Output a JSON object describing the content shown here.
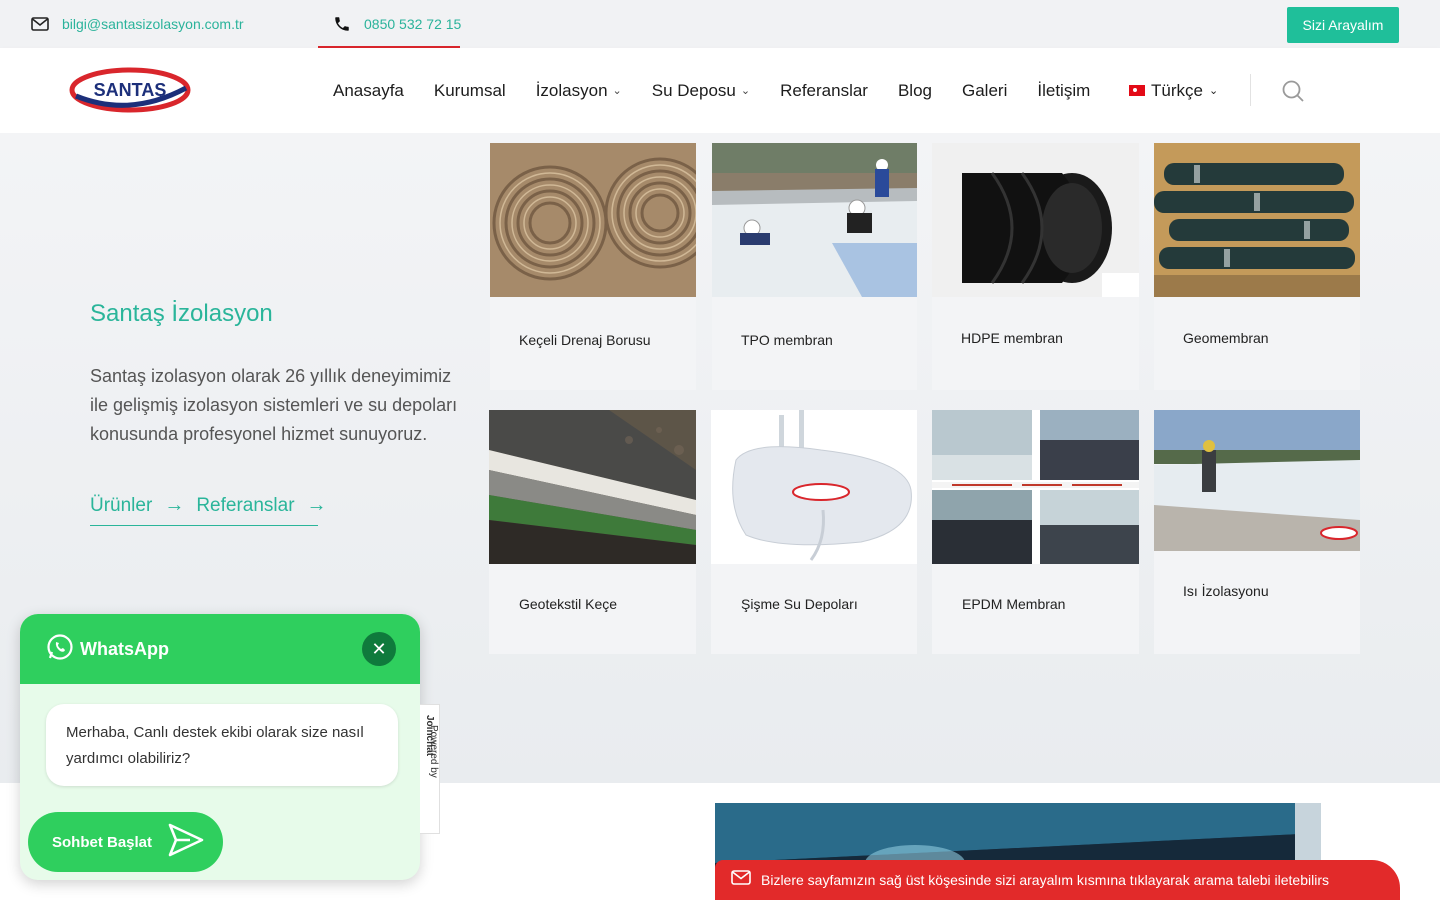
{
  "topbar": {
    "email": "bilgi@santasizolasyon.com.tr",
    "phone": "0850 532 72 15",
    "call_button": "Sizi Arayalım"
  },
  "brand": {
    "logo_text": "SANTAŞ"
  },
  "nav": {
    "items": [
      {
        "label": "Anasayfa",
        "dropdown": false
      },
      {
        "label": "Kurumsal",
        "dropdown": false
      },
      {
        "label": "İzolasyon",
        "dropdown": true
      },
      {
        "label": "Su Deposu",
        "dropdown": true
      },
      {
        "label": "Referanslar",
        "dropdown": false
      },
      {
        "label": "Blog",
        "dropdown": false
      },
      {
        "label": "Galeri",
        "dropdown": false
      },
      {
        "label": "İletişim",
        "dropdown": false
      }
    ],
    "language": "Türkçe"
  },
  "hero": {
    "title": "Santaş İzolasyon",
    "description": "Santaş izolasyon olarak 26 yıllık deneyimimiz ile gelişmiş izolasyon sistemleri ve su depoları konusunda profesyonel hizmet sunuyoruz.",
    "link_products": "Ürünler",
    "link_references": "Referanslar"
  },
  "products": [
    {
      "label": "Keçeli Drenaj Borusu"
    },
    {
      "label": "TPO membran"
    },
    {
      "label": "HDPE membran"
    },
    {
      "label": "Geomembran"
    },
    {
      "label": "Geotekstil Keçe"
    },
    {
      "label": "Şişme Su Depoları"
    },
    {
      "label": "EPDM Membran"
    },
    {
      "label": "Isı İzolasyonu"
    }
  ],
  "notice": {
    "text": "Bizlere sayfamızın sağ üst köşesinde sizi arayalım kısmına tıklayarak arama talebi iletebilirs"
  },
  "whatsapp": {
    "title": "WhatsApp",
    "message": "Merhaba, Canlı destek ekibi olarak size nasıl yardımcı olabiliriz?",
    "start_button": "Sohbet Başlat",
    "powered_prefix": "Powered by ",
    "powered_brand": "Joinchat"
  },
  "colors": {
    "accent": "#2ab59a",
    "call_button": "#1fbf9a",
    "whatsapp": "#2fcf5e",
    "notice": "#e22a2a",
    "phone_underline": "#d9262c"
  },
  "icons": {
    "email": "envelope-icon",
    "phone": "phone-icon",
    "search": "search-icon",
    "close": "close-icon",
    "send": "send-icon",
    "whatsapp": "whatsapp-icon"
  }
}
